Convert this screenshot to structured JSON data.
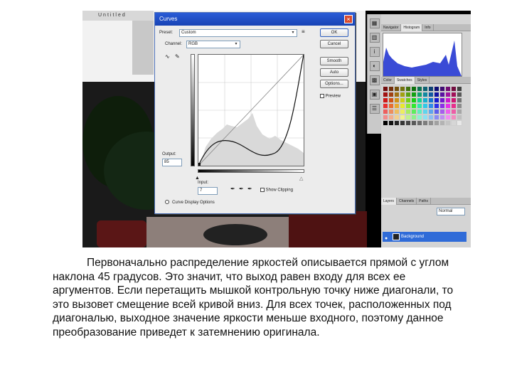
{
  "dialog": {
    "title": "Curves",
    "close_glyph": "×",
    "preset_label": "Preset:",
    "preset_value": "Custom",
    "channel_label": "Channel:",
    "channel_value": "RGB",
    "output_label": "Output:",
    "output_value": "85",
    "input_label": "Input:",
    "input_value": "7",
    "show_clipping_label": "Show Clipping",
    "curve_display_label": "Curve Display Options",
    "preview_label": "Preview",
    "buttons": {
      "ok": "OK",
      "cancel": "Cancel",
      "smooth": "Smooth",
      "auto": "Auto",
      "options": "Options..."
    }
  },
  "panels": {
    "top_tabs": [
      "Navigator",
      "Histogram",
      "Info"
    ],
    "swatch_tabs": [
      "Color",
      "Swatches",
      "Styles"
    ],
    "layer_tabs": [
      "Layers",
      "Channels",
      "Paths"
    ],
    "layer_mode": "Normal",
    "layer_name": "Background"
  },
  "background_title": "Untitled",
  "caption": "Первоначально распределение яркостей описывается прямой с углом наклона 45 градусов. Это значит, что выход равен входу для всех ее аргументов. Если перетащить мышкой контрольную точку ниже диагонали, то это вызовет смещение всей кривой вниз. Для всех точек, расположенных под диагональю, выходное значение яркости меньше входного, поэтому данное преобразование приведет к затемнению оригинала.",
  "colors": {
    "histogram": "#3a4bd6",
    "title_bar": "#1f4fc7",
    "layer_selected": "#2f6bd8"
  }
}
